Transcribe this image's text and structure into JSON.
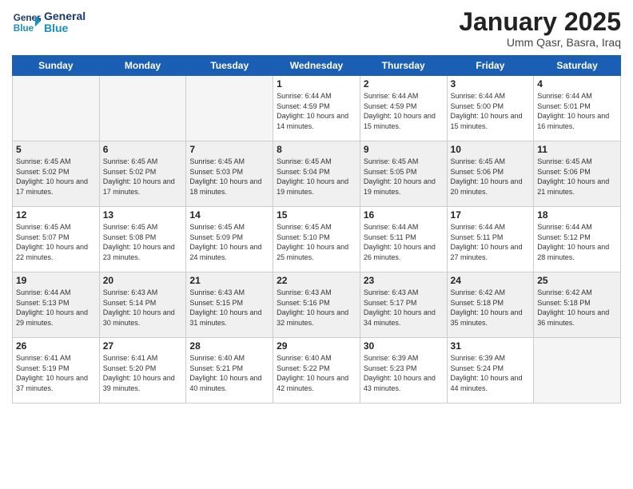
{
  "logo": {
    "line1": "General",
    "line2": "Blue"
  },
  "title": "January 2025",
  "location": "Umm Qasr, Basra, Iraq",
  "days_of_week": [
    "Sunday",
    "Monday",
    "Tuesday",
    "Wednesday",
    "Thursday",
    "Friday",
    "Saturday"
  ],
  "weeks": [
    [
      {
        "day": "",
        "empty": true
      },
      {
        "day": "",
        "empty": true
      },
      {
        "day": "",
        "empty": true
      },
      {
        "day": "1",
        "sunrise": "6:44 AM",
        "sunset": "4:59 PM",
        "daylight": "10 hours and 14 minutes."
      },
      {
        "day": "2",
        "sunrise": "6:44 AM",
        "sunset": "4:59 PM",
        "daylight": "10 hours and 15 minutes."
      },
      {
        "day": "3",
        "sunrise": "6:44 AM",
        "sunset": "5:00 PM",
        "daylight": "10 hours and 15 minutes."
      },
      {
        "day": "4",
        "sunrise": "6:44 AM",
        "sunset": "5:01 PM",
        "daylight": "10 hours and 16 minutes."
      }
    ],
    [
      {
        "day": "5",
        "sunrise": "6:45 AM",
        "sunset": "5:02 PM",
        "daylight": "10 hours and 17 minutes."
      },
      {
        "day": "6",
        "sunrise": "6:45 AM",
        "sunset": "5:02 PM",
        "daylight": "10 hours and 17 minutes."
      },
      {
        "day": "7",
        "sunrise": "6:45 AM",
        "sunset": "5:03 PM",
        "daylight": "10 hours and 18 minutes."
      },
      {
        "day": "8",
        "sunrise": "6:45 AM",
        "sunset": "5:04 PM",
        "daylight": "10 hours and 19 minutes."
      },
      {
        "day": "9",
        "sunrise": "6:45 AM",
        "sunset": "5:05 PM",
        "daylight": "10 hours and 19 minutes."
      },
      {
        "day": "10",
        "sunrise": "6:45 AM",
        "sunset": "5:06 PM",
        "daylight": "10 hours and 20 minutes."
      },
      {
        "day": "11",
        "sunrise": "6:45 AM",
        "sunset": "5:06 PM",
        "daylight": "10 hours and 21 minutes."
      }
    ],
    [
      {
        "day": "12",
        "sunrise": "6:45 AM",
        "sunset": "5:07 PM",
        "daylight": "10 hours and 22 minutes."
      },
      {
        "day": "13",
        "sunrise": "6:45 AM",
        "sunset": "5:08 PM",
        "daylight": "10 hours and 23 minutes."
      },
      {
        "day": "14",
        "sunrise": "6:45 AM",
        "sunset": "5:09 PM",
        "daylight": "10 hours and 24 minutes."
      },
      {
        "day": "15",
        "sunrise": "6:45 AM",
        "sunset": "5:10 PM",
        "daylight": "10 hours and 25 minutes."
      },
      {
        "day": "16",
        "sunrise": "6:44 AM",
        "sunset": "5:11 PM",
        "daylight": "10 hours and 26 minutes."
      },
      {
        "day": "17",
        "sunrise": "6:44 AM",
        "sunset": "5:11 PM",
        "daylight": "10 hours and 27 minutes."
      },
      {
        "day": "18",
        "sunrise": "6:44 AM",
        "sunset": "5:12 PM",
        "daylight": "10 hours and 28 minutes."
      }
    ],
    [
      {
        "day": "19",
        "sunrise": "6:44 AM",
        "sunset": "5:13 PM",
        "daylight": "10 hours and 29 minutes."
      },
      {
        "day": "20",
        "sunrise": "6:43 AM",
        "sunset": "5:14 PM",
        "daylight": "10 hours and 30 minutes."
      },
      {
        "day": "21",
        "sunrise": "6:43 AM",
        "sunset": "5:15 PM",
        "daylight": "10 hours and 31 minutes."
      },
      {
        "day": "22",
        "sunrise": "6:43 AM",
        "sunset": "5:16 PM",
        "daylight": "10 hours and 32 minutes."
      },
      {
        "day": "23",
        "sunrise": "6:43 AM",
        "sunset": "5:17 PM",
        "daylight": "10 hours and 34 minutes."
      },
      {
        "day": "24",
        "sunrise": "6:42 AM",
        "sunset": "5:18 PM",
        "daylight": "10 hours and 35 minutes."
      },
      {
        "day": "25",
        "sunrise": "6:42 AM",
        "sunset": "5:18 PM",
        "daylight": "10 hours and 36 minutes."
      }
    ],
    [
      {
        "day": "26",
        "sunrise": "6:41 AM",
        "sunset": "5:19 PM",
        "daylight": "10 hours and 37 minutes."
      },
      {
        "day": "27",
        "sunrise": "6:41 AM",
        "sunset": "5:20 PM",
        "daylight": "10 hours and 39 minutes."
      },
      {
        "day": "28",
        "sunrise": "6:40 AM",
        "sunset": "5:21 PM",
        "daylight": "10 hours and 40 minutes."
      },
      {
        "day": "29",
        "sunrise": "6:40 AM",
        "sunset": "5:22 PM",
        "daylight": "10 hours and 42 minutes."
      },
      {
        "day": "30",
        "sunrise": "6:39 AM",
        "sunset": "5:23 PM",
        "daylight": "10 hours and 43 minutes."
      },
      {
        "day": "31",
        "sunrise": "6:39 AM",
        "sunset": "5:24 PM",
        "daylight": "10 hours and 44 minutes."
      },
      {
        "day": "",
        "empty": true
      }
    ]
  ]
}
